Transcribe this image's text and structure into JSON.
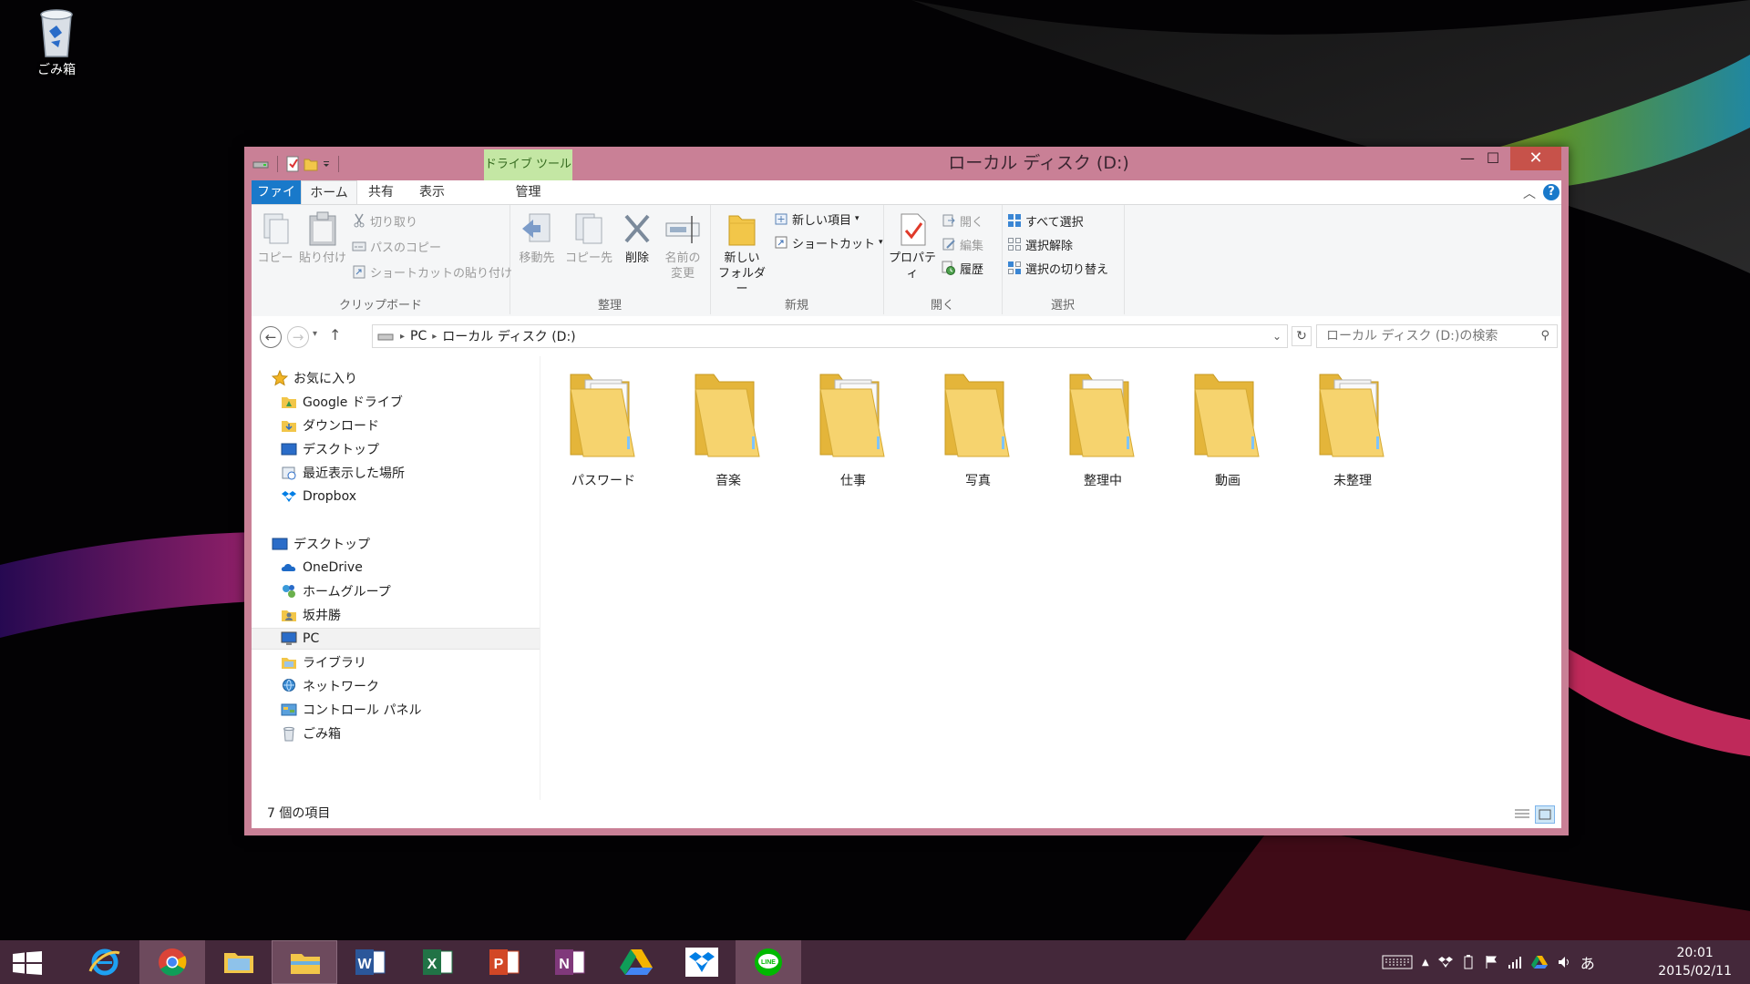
{
  "desktop": {
    "recycle_bin_label": "ごみ箱"
  },
  "window": {
    "title": "ローカル ディスク (D:)",
    "context_tab_label": "ドライブ ツール",
    "buttons": {
      "minimize": "—",
      "maximize": "☐",
      "close": "✕"
    }
  },
  "ribbon_tabs": {
    "file": "ファイル",
    "home": "ホーム",
    "share": "共有",
    "view": "表示",
    "manage": "管理"
  },
  "ribbon": {
    "clipboard": {
      "label": "クリップボード",
      "copy": "コピー",
      "paste": "貼り付け",
      "cut": "切り取り",
      "copy_path": "パスのコピー",
      "paste_shortcut": "ショートカットの貼り付け"
    },
    "organize": {
      "label": "整理",
      "move_to": "移動先",
      "copy_to": "コピー先",
      "delete": "削除",
      "rename_1": "名前の",
      "rename_2": "変更"
    },
    "new": {
      "label": "新規",
      "new_folder_1": "新しい",
      "new_folder_2": "フォルダー",
      "new_item": "新しい項目",
      "shortcut": "ショートカット"
    },
    "open": {
      "label": "開く",
      "properties": "プロパティ",
      "open": "開く",
      "edit": "編集",
      "history": "履歴"
    },
    "select": {
      "label": "選択",
      "select_all": "すべて選択",
      "select_none": "選択解除",
      "invert": "選択の切り替え"
    }
  },
  "address": {
    "crumbs": [
      "PC",
      "ローカル ディスク (D:)"
    ],
    "search_placeholder": "ローカル ディスク (D:)の検索"
  },
  "nav": {
    "favorites": "お気に入り",
    "google_drive": "Google ドライブ",
    "downloads": "ダウンロード",
    "desktop_fav": "デスクトップ",
    "recent": "最近表示した場所",
    "dropbox": "Dropbox",
    "desktop": "デスクトップ",
    "onedrive": "OneDrive",
    "homegroup": "ホームグループ",
    "user": "坂井勝",
    "pc": "PC",
    "libraries": "ライブラリ",
    "network": "ネットワーク",
    "control_panel": "コントロール パネル",
    "recycle_bin": "ごみ箱"
  },
  "folders": [
    {
      "name": "パスワード"
    },
    {
      "name": "音楽"
    },
    {
      "name": "仕事"
    },
    {
      "name": "写真"
    },
    {
      "name": "整理中"
    },
    {
      "name": "動画"
    },
    {
      "name": "未整理"
    }
  ],
  "status": {
    "item_count": "7 個の項目"
  },
  "taskbar": {
    "ime": "あ",
    "time": "20:01",
    "date": "2015/02/11",
    "apps": [
      "windows-start",
      "internet-explorer",
      "chrome",
      "explorer-alt",
      "file-explorer",
      "word",
      "excel",
      "powerpoint",
      "onenote",
      "google-drive",
      "dropbox",
      "line"
    ],
    "colors": {
      "word": "#2b579a",
      "excel": "#217346",
      "powerpoint": "#d24726",
      "onenote": "#80397b",
      "line": "#00b900",
      "dropbox": "#007ee5"
    }
  }
}
